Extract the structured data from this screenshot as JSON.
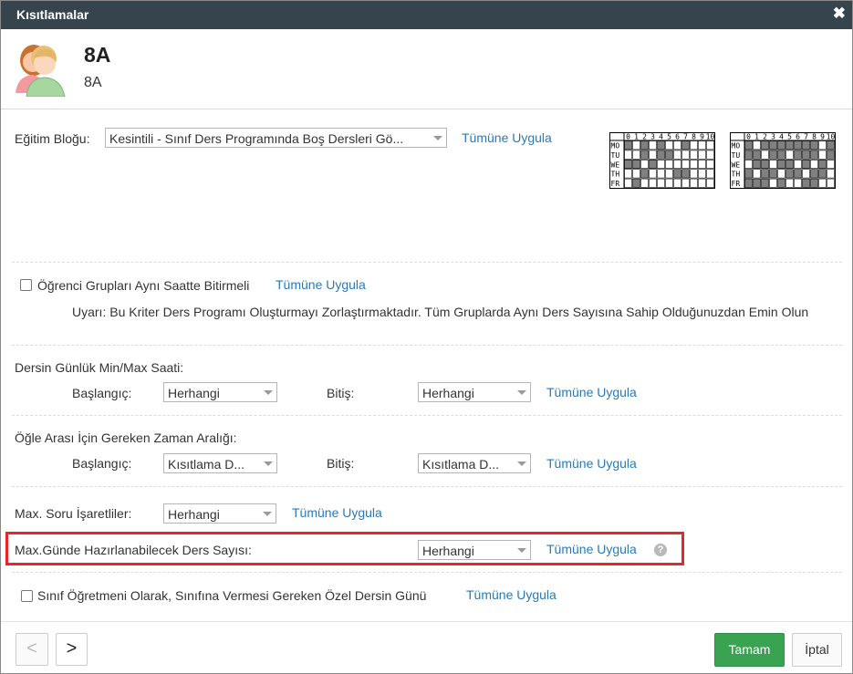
{
  "dialog": {
    "title": "Kısıtlamalar",
    "close_icon": "close-icon",
    "class_name": "8A",
    "class_subtitle": "8A"
  },
  "education_block": {
    "label": "Eğitim Bloğu:",
    "value": "Kesintili - Sınıf Ders Programında Boş Dersleri Gö...",
    "apply_label": "Tümüne Uygula"
  },
  "schedule_preview": {
    "col_headers": [
      "0",
      "1",
      "2",
      "3",
      "4",
      "5",
      "6",
      "7",
      "8",
      "9",
      "10"
    ],
    "rows": [
      "MO",
      "TU",
      "WE",
      "TH",
      "FR"
    ],
    "grid1": [
      [
        1,
        0,
        1,
        0,
        1,
        0,
        0,
        1,
        0,
        0,
        0
      ],
      [
        0,
        0,
        1,
        0,
        1,
        1,
        0,
        0,
        0,
        0,
        0
      ],
      [
        1,
        1,
        0,
        1,
        0,
        0,
        0,
        0,
        0,
        0,
        0
      ],
      [
        0,
        0,
        1,
        0,
        0,
        0,
        1,
        1,
        0,
        0,
        0
      ],
      [
        0,
        1,
        0,
        0,
        0,
        0,
        0,
        0,
        0,
        0,
        0
      ]
    ],
    "grid2": [
      [
        1,
        0,
        1,
        1,
        1,
        1,
        1,
        1,
        1,
        0,
        1
      ],
      [
        1,
        1,
        0,
        1,
        1,
        0,
        1,
        1,
        1,
        0,
        1
      ],
      [
        0,
        1,
        1,
        0,
        1,
        1,
        0,
        1,
        0,
        1,
        0
      ],
      [
        1,
        0,
        1,
        1,
        0,
        1,
        1,
        0,
        1,
        1,
        0
      ],
      [
        1,
        1,
        1,
        0,
        1,
        0,
        0,
        1,
        1,
        0,
        0
      ]
    ],
    "header_color": "#000000",
    "filled_color": "#808080",
    "empty_color": "#ffffff"
  },
  "same_time": {
    "checked": false,
    "label": "Öğrenci Grupları Aynı Saatte Bitirmeli",
    "apply_label": "Tümüne Uygula",
    "warning": "Uyarı: Bu Kriter Ders Programı Oluşturmayı Zorlaştırmaktadır. Tüm Gruplarda Aynı Ders Sayısına Sahip Olduğunuzdan Emin Olun"
  },
  "daily_minmax": {
    "title": "Dersin Günlük Min/Max Saati:",
    "start_label": "Başlangıç:",
    "start_value": "Herhangi",
    "end_label": "Bitiş:",
    "end_value": "Herhangi",
    "apply_label": "Tümüne Uygula"
  },
  "lunch": {
    "title": "Öğle Arası İçin Gereken Zaman Aralığı:",
    "start_label": "Başlangıç:",
    "start_value": "Kısıtlama D...",
    "end_label": "Bitiş:",
    "end_value": "Kısıtlama D...",
    "apply_label": "Tümüne Uygula"
  },
  "max_question": {
    "label": "Max. Soru İşaretliler:",
    "value": "Herhangi",
    "apply_label": "Tümüne Uygula"
  },
  "max_daily_prep": {
    "label": "Max.Günde Hazırlanabilecek Ders Sayısı:",
    "value": "Herhangi",
    "apply_label": "Tümüne Uygula",
    "help_icon": "question-icon",
    "help_glyph": "?",
    "highlight_color": "#e8262a"
  },
  "special_day": {
    "checked": false,
    "label": "Sınıf Öğretmeni Olarak, Sınıfına Vermesi Gereken Özel Dersin Günü",
    "apply_label": "Tümüne Uygula"
  },
  "footer": {
    "prev_label": "<",
    "next_label": ">",
    "ok_label": "Tamam",
    "cancel_label": "İptal",
    "ok_color": "#3aa352"
  }
}
